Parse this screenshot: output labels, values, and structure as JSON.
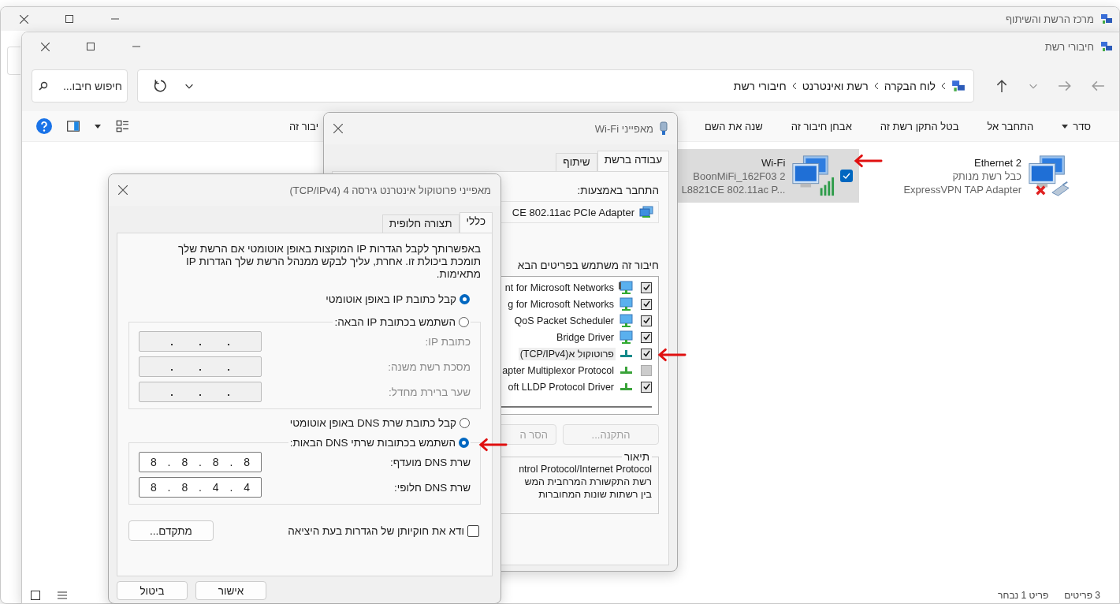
{
  "back_window": {
    "title": "מרכז הרשת והשיתוף"
  },
  "main_window": {
    "title": "חיבורי רשת",
    "breadcrumb": [
      "לוח הבקרה",
      "רשת ואינטרנט",
      "חיבורי רשת"
    ],
    "search": {
      "placeholder": "חיפוש חיבו..."
    },
    "commands": [
      {
        "label": "סדר",
        "kind": "menu"
      },
      {
        "label": "התחבר אל",
        "kind": "plain"
      },
      {
        "label": "בטל התקן רשת זה",
        "kind": "plain"
      },
      {
        "label": "אבחן חיבור זה",
        "kind": "plain"
      },
      {
        "label": "שנה את השם",
        "kind": "plain"
      }
    ],
    "command_cut": "יבור זה",
    "adapters": [
      {
        "name": "Ethernet 2",
        "status": "כבל רשת מנותק",
        "device": "ExpressVPN TAP Adapter",
        "kind": "wired",
        "disconnected": true,
        "selected": false
      },
      {
        "name": "Wi-Fi",
        "status": "BoonMiFi_162F03 2",
        "device": "L8821CE 802.11ac P...",
        "kind": "wireless",
        "disconnected": false,
        "selected": true
      }
    ],
    "status_bar": [
      "3 פריטים",
      "פריט 1 נבחר"
    ]
  },
  "wifi_dialog": {
    "title": "מאפייני Wi-Fi",
    "tabs": [
      {
        "label": "עבודה ברשת",
        "selected": true
      },
      {
        "label": "שיתוף",
        "selected": false
      }
    ],
    "connect_label": "התחבר באמצעות:",
    "adapter": "CE 802.11ac PCIe Adapter",
    "items_label": "חיבור זה משתמש בפריטים הבא",
    "items": [
      {
        "label": "nt for Microsoft Networks",
        "kind": "client",
        "checked": true,
        "selected": false
      },
      {
        "label": "g for Microsoft Networks",
        "kind": "service",
        "checked": true,
        "selected": false
      },
      {
        "label": "QoS Packet Scheduler",
        "kind": "service",
        "checked": true,
        "selected": false
      },
      {
        "label": "Bridge Driver",
        "kind": "service",
        "checked": true,
        "selected": false
      },
      {
        "label": "פרוטוקול א(TCP/IPv4)",
        "kind": "protocol",
        "checked": true,
        "selected": true
      },
      {
        "label": "apter Multiplexor Protocol",
        "kind": "protocol",
        "checked": false,
        "selected": false
      },
      {
        "label": "oft LLDP Protocol Driver",
        "kind": "protocol",
        "checked": true,
        "selected": false
      }
    ],
    "buttons": [
      {
        "label": "התקנה...",
        "disabled": true
      },
      {
        "label": "הסר ה",
        "disabled": true
      }
    ],
    "description_title": "תיאור",
    "description": [
      "ntrol Protocol/Internet Protocol",
      "רשת התקשורת המרחבית המש",
      "בין רשתות שונות המחוברות"
    ]
  },
  "ipv4_dialog": {
    "title": "מאפייני פרוטוקול אינטרנט גירסה 4 (TCP/IPv4)",
    "tabs": [
      {
        "label": "כללי",
        "selected": true
      },
      {
        "label": "תצורה חלופית",
        "selected": false
      }
    ],
    "intro": "באפשרותך לקבל הגדרות IP המוקצות באופן אוטומטי אם הרשת שלך תומכת ביכולת זו. אחרת, עליך לבקש ממנהל הרשת שלך הגדרות IP מתאימות.",
    "ip_auto": {
      "label": "קבל כתובת IP באופן אוטומטי",
      "selected": true
    },
    "ip_manual": {
      "label": "השתמש בכתובת IP הבאה:",
      "selected": false,
      "fields": [
        {
          "label": "כתובת IP:"
        },
        {
          "label": "מסכת רשת משנה:"
        },
        {
          "label": "שער ברירת מחדל:"
        }
      ]
    },
    "dns_auto": {
      "label": "קבל כתובת שרת DNS באופן אוטומטי",
      "selected": false
    },
    "dns_manual": {
      "label": "השתמש בכתובות שרתי DNS הבאות:",
      "selected": true,
      "fields": [
        {
          "label": "שרת DNS מועדף:",
          "value": "8 . 8 . 8 . 8"
        },
        {
          "label": "שרת DNS חלופי:",
          "value": "8 . 8 . 4 . 4"
        }
      ]
    },
    "validate": {
      "label": "ודא את חוקיותן של הגדרות בעת היציאה",
      "checked": false
    },
    "advanced": "מתקדם...",
    "buttons": [
      "אישור",
      "ביטול"
    ]
  }
}
